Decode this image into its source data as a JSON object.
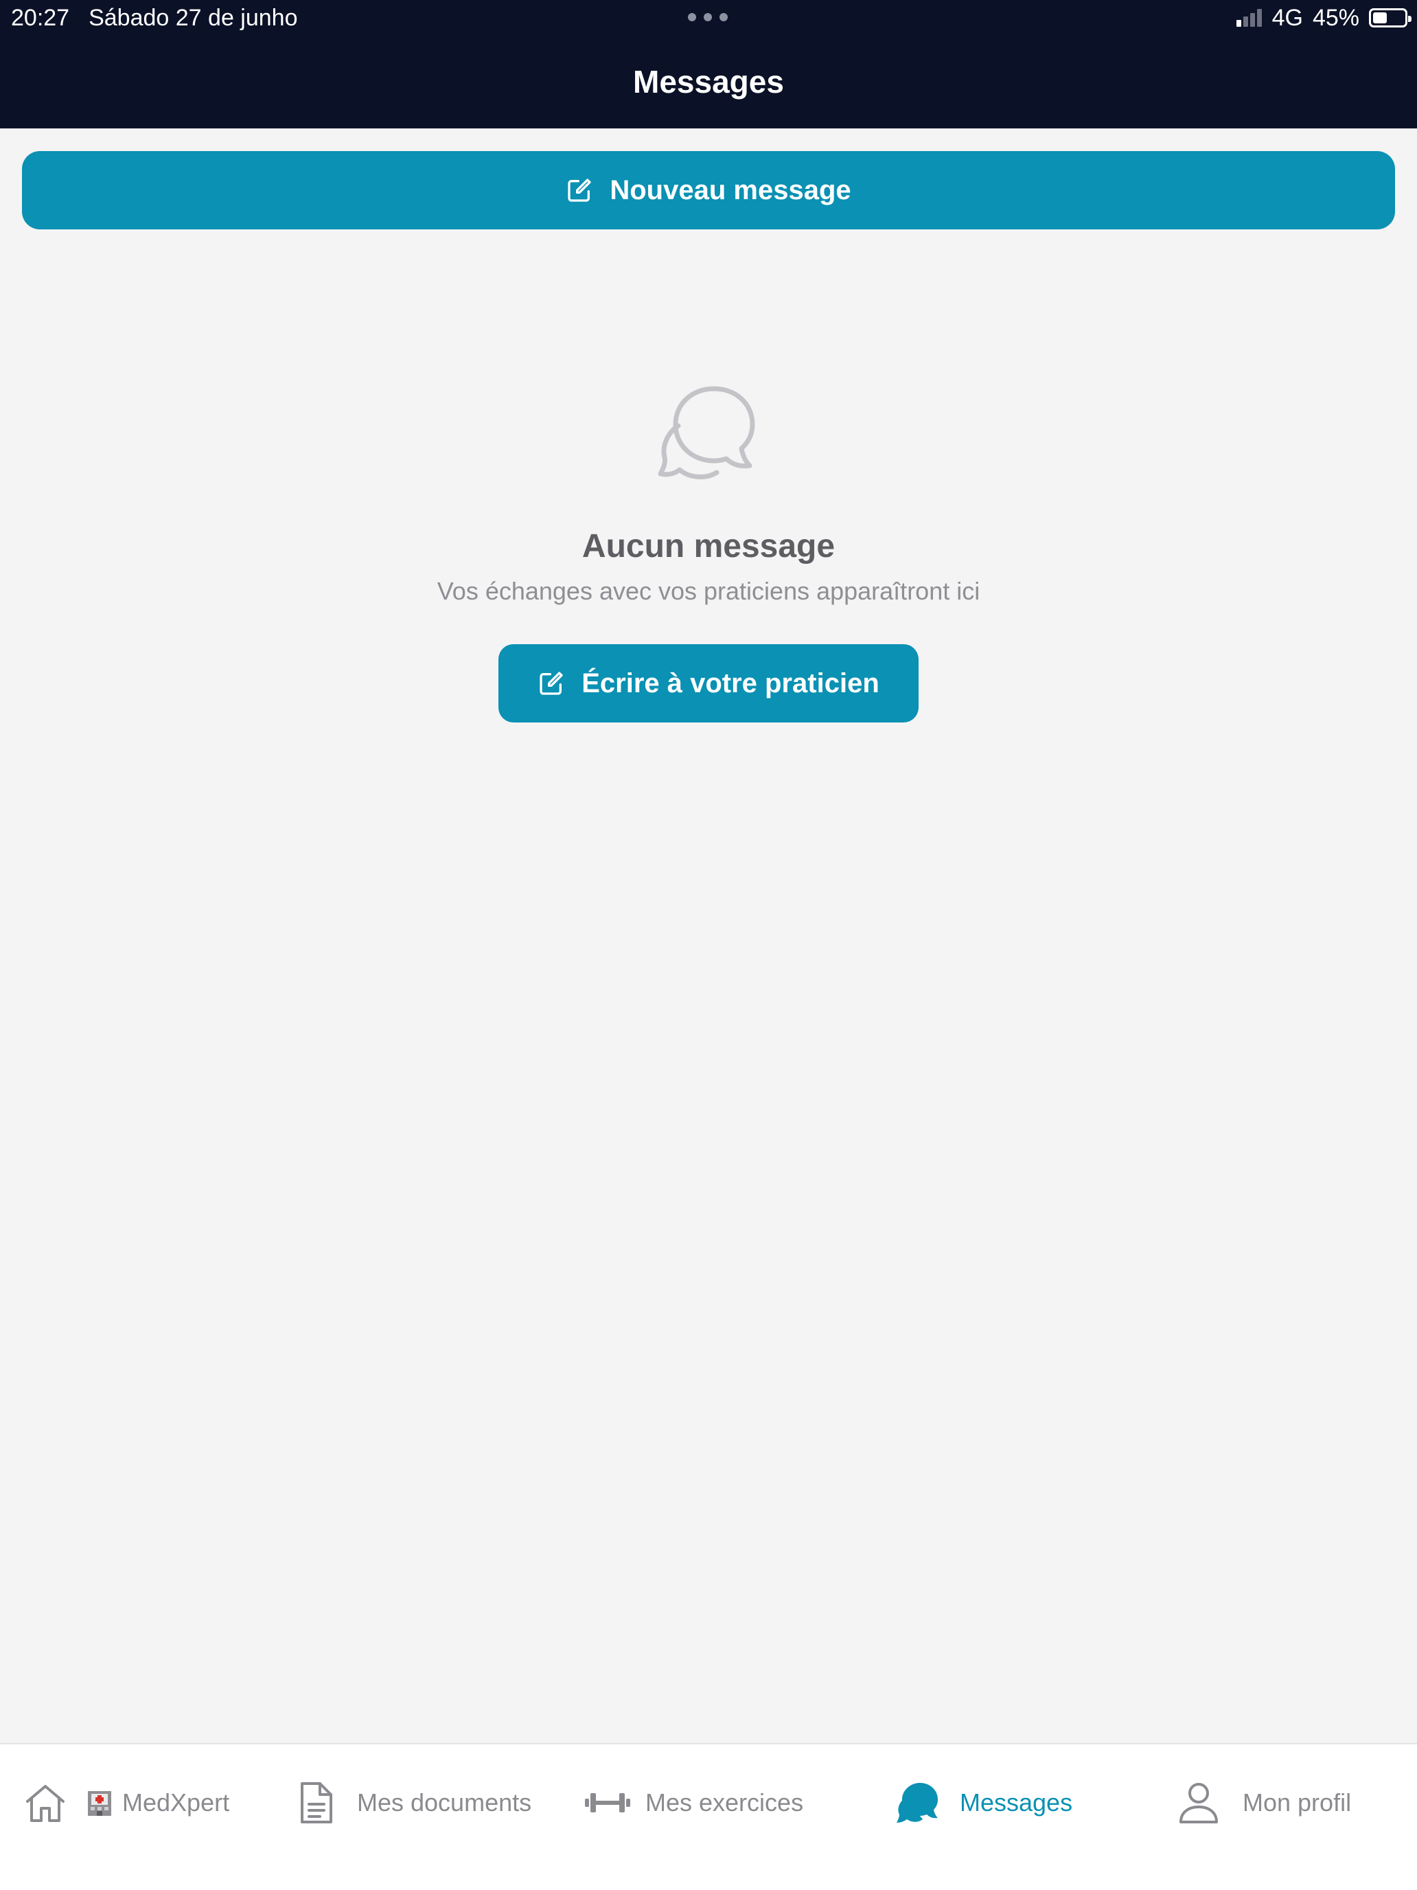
{
  "status_bar": {
    "time": "20:27",
    "date": "Sábado 27 de junho",
    "network": "4G",
    "battery": "45%",
    "battery_level": 0.45
  },
  "header": {
    "title": "Messages"
  },
  "actions": {
    "new_message": "Nouveau message",
    "write_practitioner": "Écrire à votre praticien"
  },
  "empty_state": {
    "icon": "chat-bubbles-icon",
    "title": "Aucun message",
    "subtitle": "Vos échanges avec vos praticiens apparaîtront ici"
  },
  "tabbar": {
    "active": "messages",
    "items": [
      {
        "id": "home",
        "label": "MedXpert",
        "icon": "home-icon"
      },
      {
        "id": "documents",
        "label": "Mes documents",
        "icon": "document-icon"
      },
      {
        "id": "exercises",
        "label": "Mes exercices",
        "icon": "dumbbell-icon"
      },
      {
        "id": "messages",
        "label": "Messages",
        "icon": "chat-icon"
      },
      {
        "id": "profile",
        "label": "Mon profil",
        "icon": "user-icon"
      }
    ]
  },
  "colors": {
    "header_bg": "#0b1126",
    "accent": "#0a91b3",
    "page_bg": "#f4f4f5",
    "tab_inactive": "#8a8a8f"
  }
}
